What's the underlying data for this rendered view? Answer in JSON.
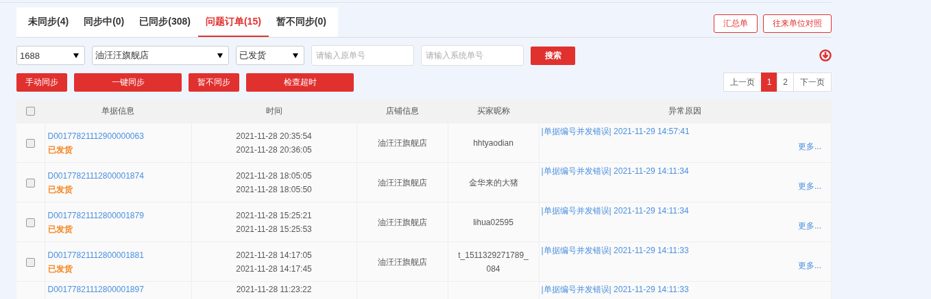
{
  "tabs": [
    {
      "label": "未同步(4)",
      "selected": false
    },
    {
      "label": "同步中(0)",
      "selected": false
    },
    {
      "label": "已同步(308)",
      "selected": false
    },
    {
      "label": "问题订单(15)",
      "selected": true
    },
    {
      "label": "暂不同步(0)",
      "selected": false
    }
  ],
  "top_buttons": [
    "汇总单",
    "往来单位对照"
  ],
  "filters": {
    "platform": "1688",
    "shop": "油汪汪旗舰店",
    "status": "已发货",
    "original_no": {
      "placeholder": "请输入原单号"
    },
    "system_no": {
      "placeholder": "请输入系统单号"
    },
    "search_button": "搜索"
  },
  "action_buttons": [
    "手动同步",
    "一键同步",
    "暂不同步",
    "检查超时"
  ],
  "pagination": {
    "prev": "上一页",
    "pages": [
      {
        "label": "1",
        "selected": true
      },
      {
        "label": "2",
        "selected": false
      }
    ],
    "next": "下一页"
  },
  "table": {
    "select_all_checked": false,
    "columns": [
      "单据信息",
      "时间",
      "店铺信息",
      "买家昵称",
      "异常原因"
    ],
    "rows": [
      {
        "checked": false,
        "order_no": "D00177821112900000063",
        "status": "已发货",
        "time_1": "2021-11-28 20:35:54",
        "time_2": "2021-11-28 20:36:05",
        "shop": "油汪汪旗舰店",
        "buyer": "hhtyaodian",
        "reason": "|单据编号并发错误| 2021-11-29 14:57:41",
        "more": "更多..."
      },
      {
        "checked": false,
        "order_no": "D00177821112800001874",
        "status": "已发货",
        "time_1": "2021-11-28 18:05:05",
        "time_2": "2021-11-28 18:05:50",
        "shop": "油汪汪旗舰店",
        "buyer": "金华来的大猪",
        "reason": "|单据编号并发错误| 2021-11-29 14:11:34",
        "more": "更多..."
      },
      {
        "checked": false,
        "order_no": "D00177821112800001879",
        "status": "已发货",
        "time_1": "2021-11-28 15:25:21",
        "time_2": "2021-11-28 15:25:53",
        "shop": "油汪汪旗舰店",
        "buyer": "lihua02595",
        "reason": "|单据编号并发错误| 2021-11-29 14:11:34",
        "more": "更多..."
      },
      {
        "checked": false,
        "order_no": "D00177821112800001881",
        "status": "已发货",
        "time_1": "2021-11-28 14:17:05",
        "time_2": "2021-11-28 14:17:45",
        "shop": "油汪汪旗舰店",
        "buyer": "t_1511329271789_084",
        "reason": "|单据编号并发错误| 2021-11-29 14:11:33",
        "more": "更多..."
      },
      {
        "order_no": "D00177821112800001897",
        "time_1": "2021-11-28 11:23:22",
        "reason": "|单据编号并发错误| 2021-11-29 14:11:33"
      }
    ]
  }
}
